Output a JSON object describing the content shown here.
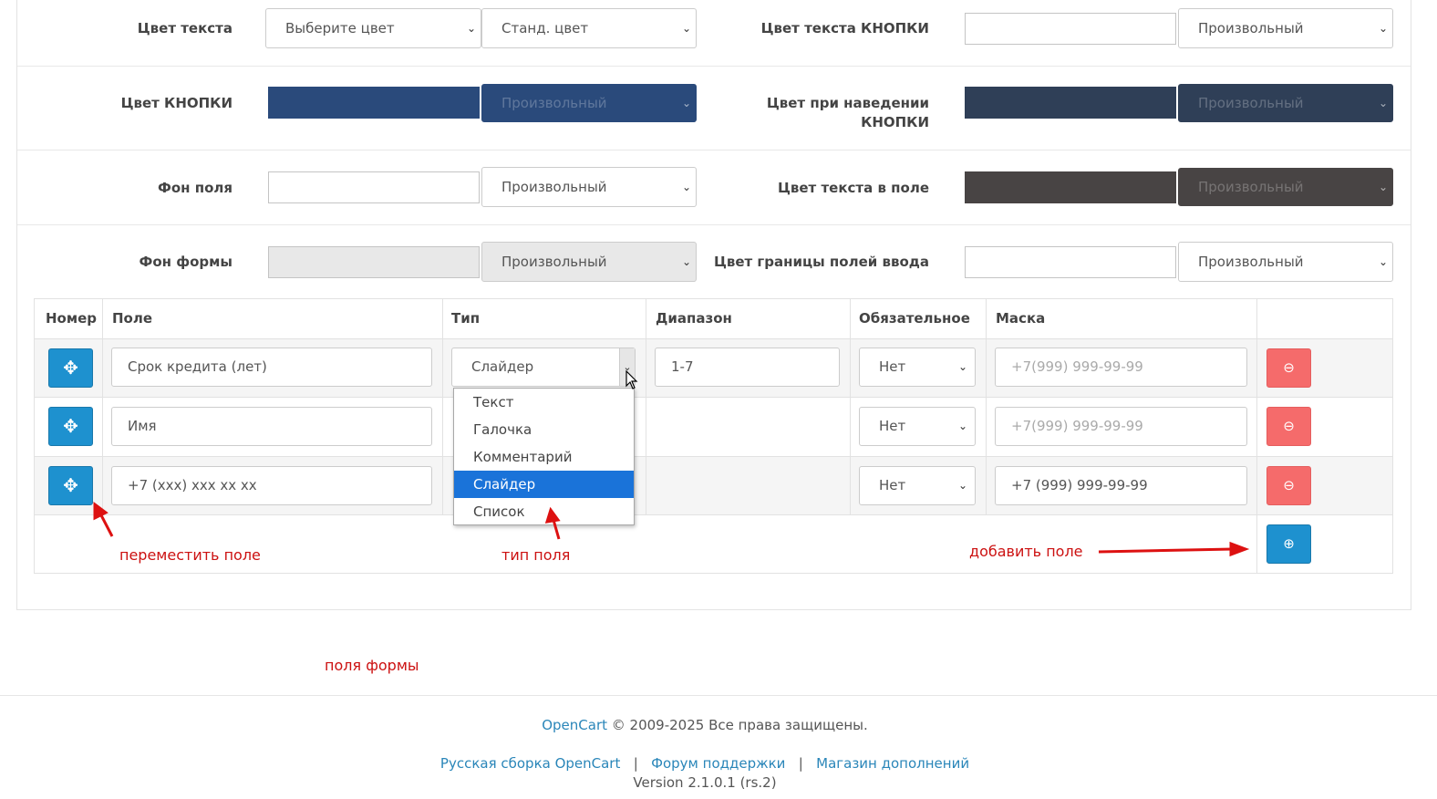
{
  "settings": {
    "text_color": {
      "label": "Цвет текста",
      "select1": "Выберите цвет",
      "select2": "Станд. цвет"
    },
    "button_text_color": {
      "label": "Цвет текста КНОПКИ",
      "select": "Произвольный"
    },
    "button_color": {
      "label": "Цвет КНОПКИ",
      "select": "Произвольный",
      "swatch": "#2a4a7b"
    },
    "button_hover_color": {
      "label_line1": "Цвет при наведении",
      "label_line2": "КНОПКИ",
      "select": "Произвольный",
      "swatch": "#2f3f57"
    },
    "field_bg": {
      "label": "Фон поля",
      "select": "Произвольный"
    },
    "field_text_color": {
      "label": "Цвет текста в поле",
      "select": "Произвольный",
      "swatch": "#484444"
    },
    "form_bg": {
      "label": "Фон формы",
      "select": "Произвольный",
      "swatch": "#e8e8e8"
    },
    "input_border_color": {
      "label": "Цвет границы полей ввода",
      "select": "Произвольный"
    }
  },
  "table": {
    "headers": {
      "number": "Номер",
      "field": "Поле",
      "type": "Тип",
      "range": "Диапазон",
      "required": "Обязательное",
      "mask": "Маска"
    },
    "rows": [
      {
        "field": "Срок кредита (лет)",
        "type": "Слайдер",
        "range": "1-7",
        "required": "Нет",
        "mask": "+7(999) 999-99-99",
        "mask_is_placeholder": true
      },
      {
        "field": "Имя",
        "required": "Нет",
        "mask": "+7(999) 999-99-99",
        "mask_is_placeholder": true
      },
      {
        "field": "+7 (xxx) xxx xx xx",
        "required": "Нет",
        "mask": "+7 (999) 999-99-99",
        "mask_is_placeholder": false
      }
    ]
  },
  "type_dropdown": {
    "options": [
      "Текст",
      "Галочка",
      "Комментарий",
      "Слайдер",
      "Список"
    ],
    "selected": "Слайдер"
  },
  "annotations": {
    "move": "переместить поле",
    "type": "тип поля",
    "add": "добавить поле",
    "form_fields": "поля формы",
    "color": "#cc1111"
  },
  "footer": {
    "brand": "OpenCart",
    "copyright": "© 2009-2025 Все права защищены.",
    "link1": "Русская сборка OpenCart",
    "sep": "|",
    "link2": "Форум поддержки",
    "link3": "Магазин дополнений",
    "version": "Version 2.1.0.1 (rs.2)"
  },
  "colors": {
    "primary": "#1e91cf",
    "danger": "#f56b6b",
    "link": "#2a86b9"
  },
  "icons": {
    "move": "arrows-move-icon",
    "remove": "minus-circle-icon",
    "add": "plus-circle-icon",
    "chevron": "chevron-down-icon"
  }
}
